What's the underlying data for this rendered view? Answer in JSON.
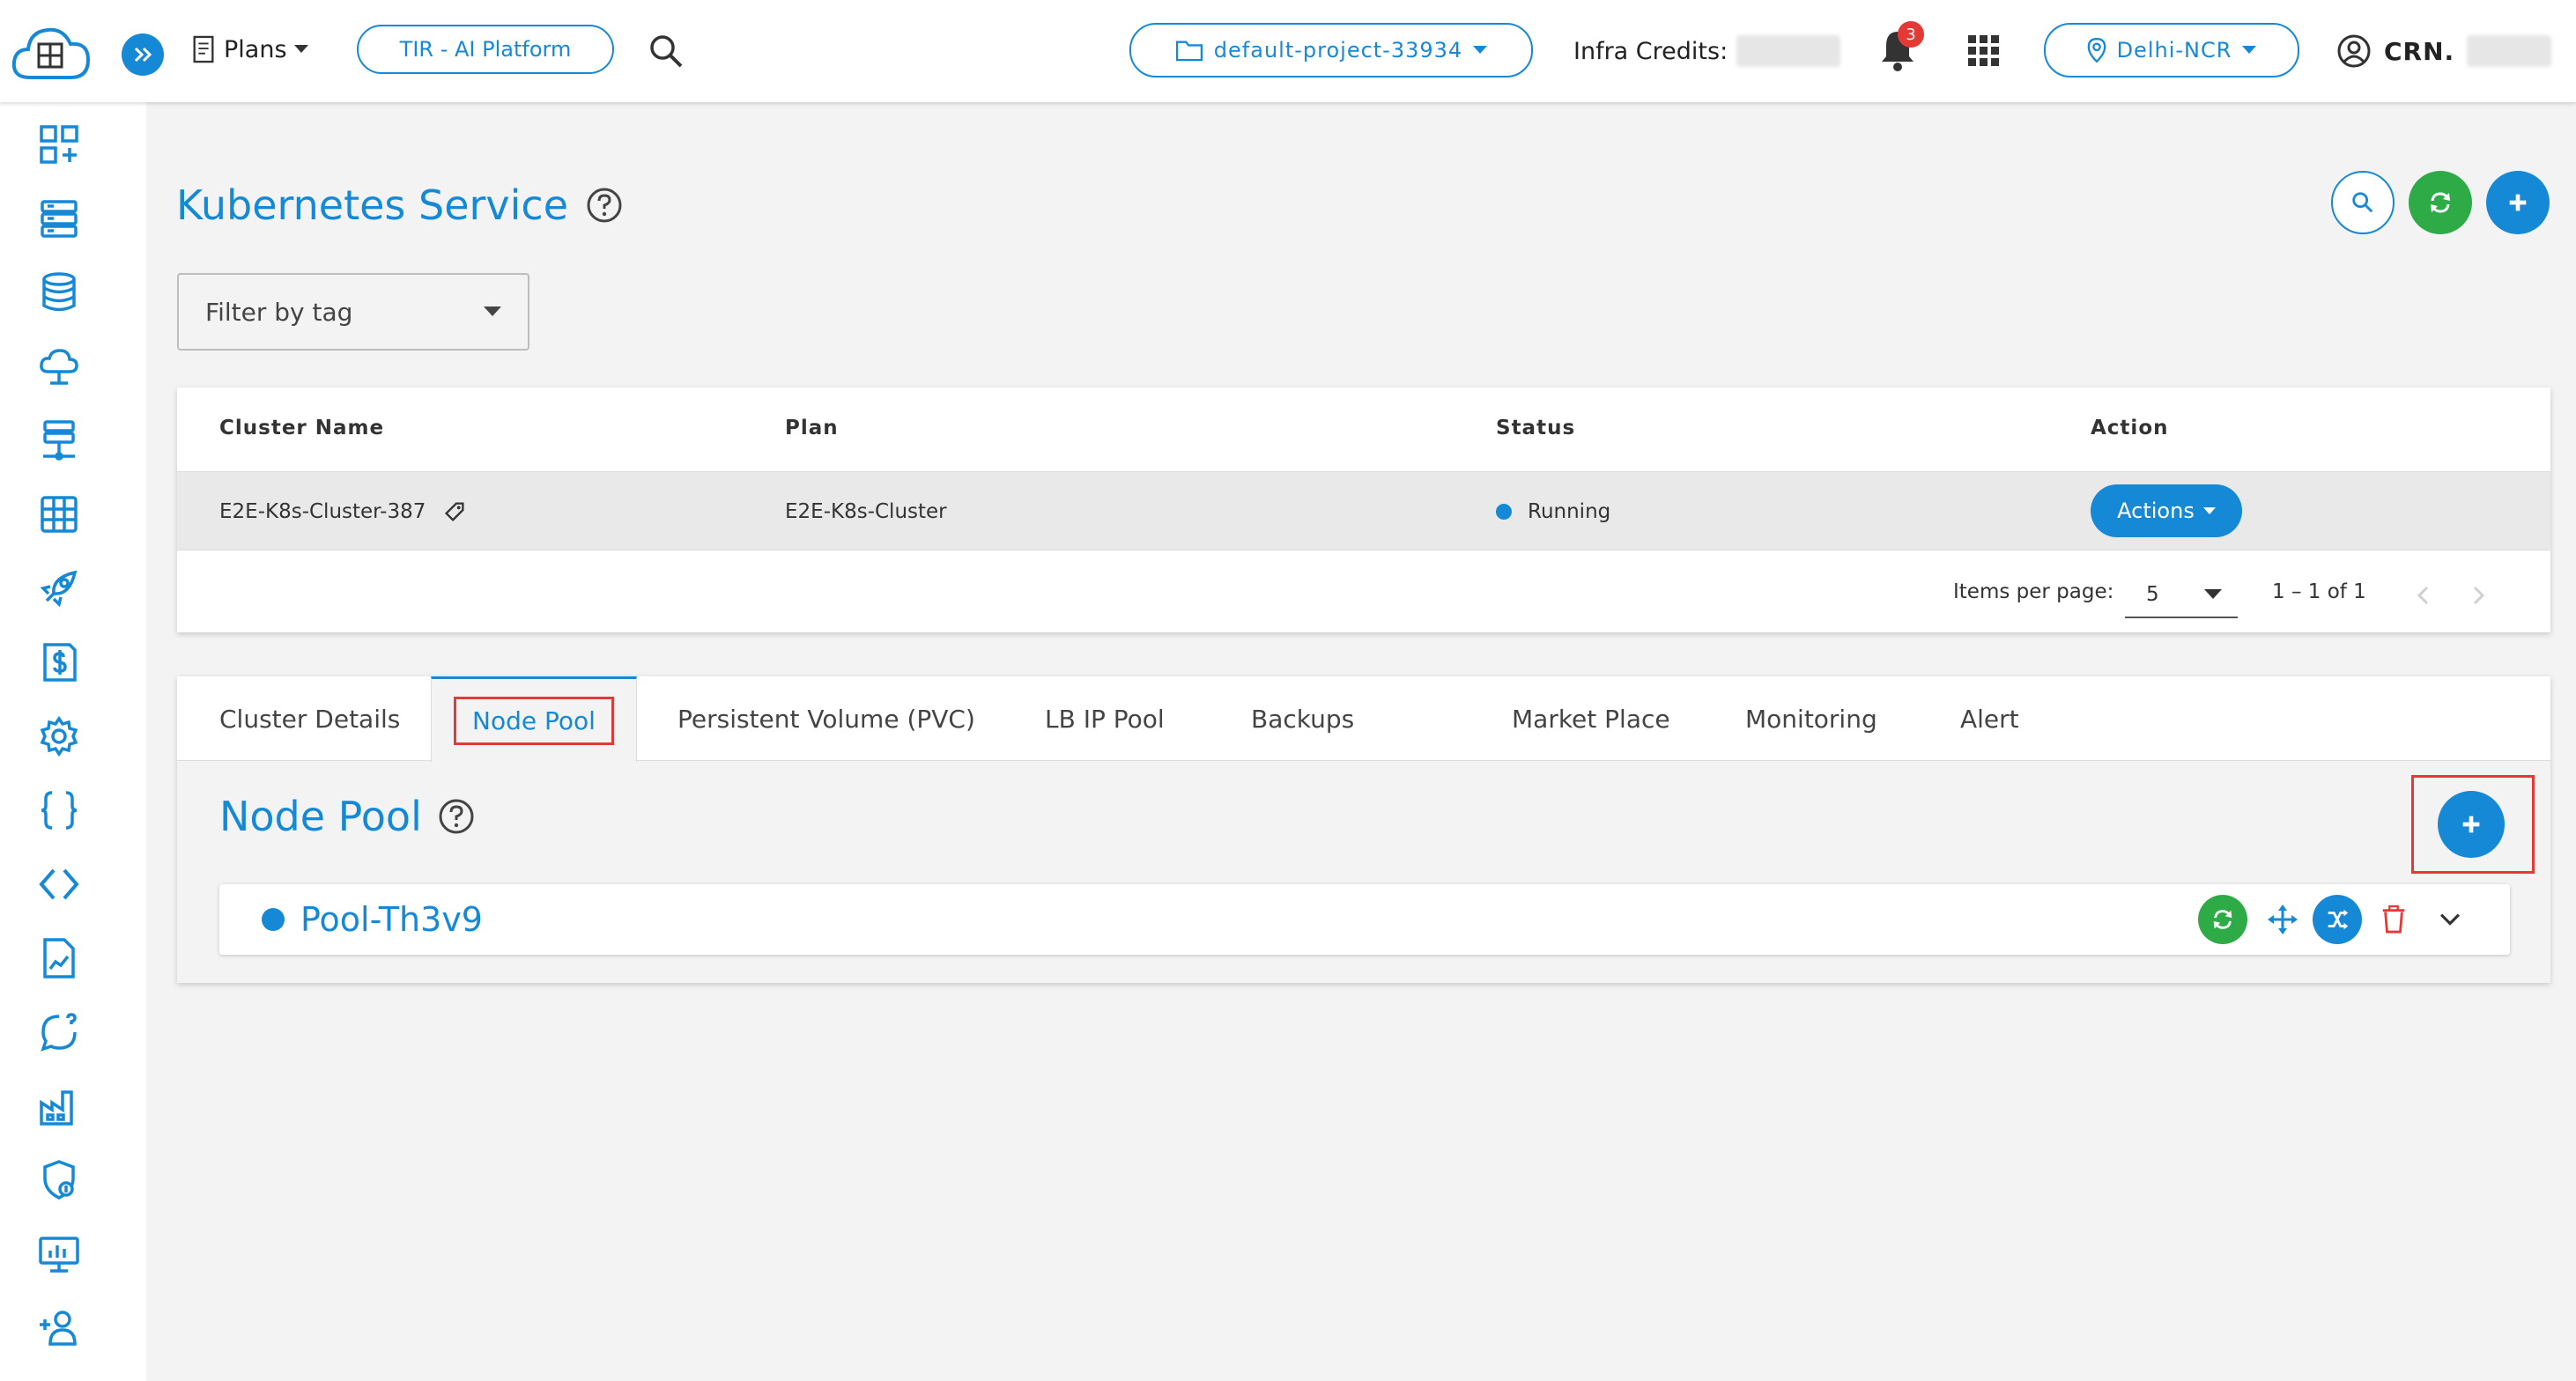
{
  "header": {
    "logo_icon": "e2e-cloud-logo",
    "plans_label": "Plans",
    "platform_label": "TIR - AI Platform",
    "project_label": "default-project-33934",
    "infra_credits_label": "Infra Credits:",
    "notification_count": "3",
    "region_label": "Delhi-NCR",
    "crn_label": "CRN."
  },
  "sidebar": {
    "items": [
      {
        "icon": "dashboard-add-icon"
      },
      {
        "icon": "server-icon"
      },
      {
        "icon": "database-icon"
      },
      {
        "icon": "cloud-upload-icon"
      },
      {
        "icon": "network-server-icon"
      },
      {
        "icon": "grid-table-icon"
      },
      {
        "icon": "rocket-icon"
      },
      {
        "icon": "billing-icon"
      },
      {
        "icon": "settings-gear-icon"
      },
      {
        "icon": "curly-braces-icon"
      },
      {
        "icon": "code-brackets-icon"
      },
      {
        "icon": "document-chart-icon"
      },
      {
        "icon": "support-chat-icon"
      },
      {
        "icon": "factory-icon"
      },
      {
        "icon": "security-shield-icon"
      },
      {
        "icon": "monitor-chart-icon"
      },
      {
        "icon": "add-user-icon"
      }
    ]
  },
  "main": {
    "title": "Kubernetes Service",
    "filter_label": "Filter by tag",
    "table": {
      "columns": [
        "Cluster Name",
        "Plan",
        "Status",
        "Action"
      ],
      "rows": [
        {
          "cluster_name": "E2E-K8s-Cluster-387",
          "plan": "E2E-K8s-Cluster",
          "status": "Running",
          "action_label": "Actions"
        }
      ],
      "items_per_page_label": "Items per page:",
      "items_per_page_value": "5",
      "range_label": "1 – 1 of 1"
    },
    "tabs": [
      {
        "label": "Cluster Details"
      },
      {
        "label": "Node Pool",
        "active": true
      },
      {
        "label": "Persistent Volume (PVC)"
      },
      {
        "label": "LB IP Pool"
      },
      {
        "label": "Backups"
      },
      {
        "label": "Market Place"
      },
      {
        "label": "Monitoring"
      },
      {
        "label": "Alert"
      }
    ],
    "node_pool": {
      "title": "Node Pool",
      "pools": [
        {
          "name": "Pool-Th3v9"
        }
      ]
    }
  },
  "colors": {
    "accent": "#1689d6",
    "success": "#2eaa47",
    "danger": "#e53935"
  }
}
